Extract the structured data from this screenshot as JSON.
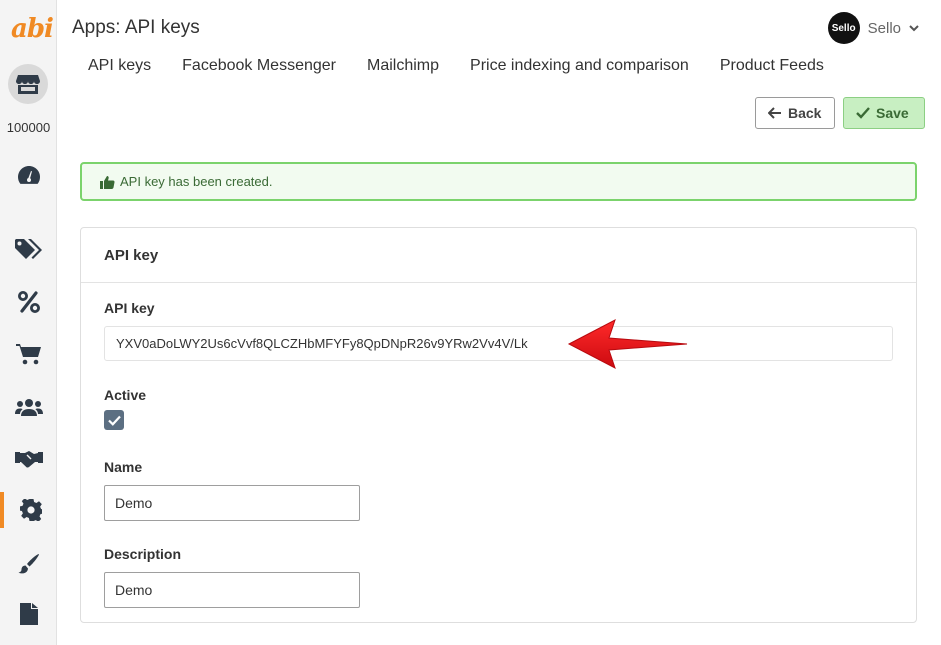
{
  "app": {
    "logo_text": "abi",
    "shop_id": "100000"
  },
  "header": {
    "title": "Apps: API keys",
    "user_initials": "Sello",
    "user_name": "Sello"
  },
  "tabs": [
    {
      "label": "API keys"
    },
    {
      "label": "Facebook Messenger"
    },
    {
      "label": "Mailchimp"
    },
    {
      "label": "Price indexing and comparison"
    },
    {
      "label": "Product Feeds"
    }
  ],
  "toolbar": {
    "back_label": "Back",
    "save_label": "Save"
  },
  "alert": {
    "message": "API key has been created."
  },
  "card": {
    "title": "API key",
    "api_key_label": "API key",
    "api_key_value": "YXV0aDoLWY2Us6cVvf8QLCZHbMFYFy8QpDNpR26v9YRw2Vv4V/Lk",
    "active_label": "Active",
    "active_checked": true,
    "name_label": "Name",
    "name_value": "Demo",
    "description_label": "Description",
    "description_value": "Demo"
  },
  "sidebar": {
    "icons": [
      "store-icon",
      "dashboard-icon",
      "tags-icon",
      "percent-icon",
      "cart-icon",
      "users-icon",
      "handshake-icon",
      "gear-icon",
      "brush-icon",
      "file-icon"
    ],
    "active": "gear-icon"
  },
  "colors": {
    "accent": "#f08a24",
    "success_border": "#7bd36c",
    "annotation_arrow": "#e8141a"
  }
}
